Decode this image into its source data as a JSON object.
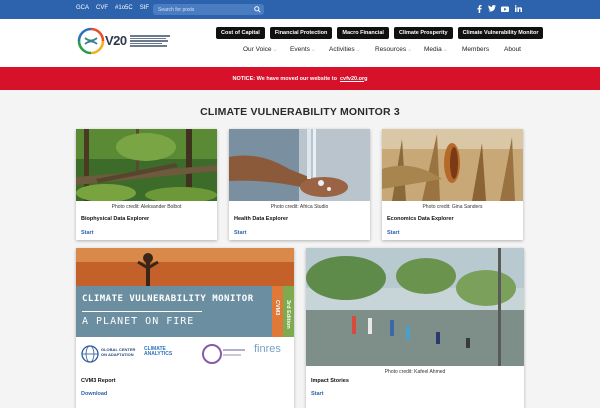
{
  "topbar": {
    "quick_links": [
      "GCA",
      "CVF",
      "#1o5C",
      "SIF"
    ],
    "search_placeholder": "Search for posts",
    "social_icons": [
      "facebook-icon",
      "twitter-icon",
      "youtube-icon",
      "linkedin-icon"
    ]
  },
  "header": {
    "logo_text": "V20",
    "pills": [
      "Cost of Capital",
      "Financial Protection",
      "Macro Financial",
      "Climate Prosperity",
      "Climate Vulnerability Monitor"
    ],
    "nav": [
      {
        "label": "Our Voice",
        "dropdown": true
      },
      {
        "label": "Events",
        "dropdown": true
      },
      {
        "label": "Activities",
        "dropdown": true
      },
      {
        "label": "Resources",
        "dropdown": true
      },
      {
        "label": "Media",
        "dropdown": true
      },
      {
        "label": "Members",
        "dropdown": false
      },
      {
        "label": "About",
        "dropdown": false
      }
    ]
  },
  "notice": {
    "text": "NOTICE: We have moved our website to",
    "link": "cvfv20.org"
  },
  "main": {
    "title": "CLIMATE VULNERABILITY MONITOR 3",
    "cards": [
      {
        "credit": "Photo credit: Aleksander Bolbot",
        "title": "Biophysical Data Explorer",
        "link": "Start"
      },
      {
        "credit": "Photo credit: Africa Studio",
        "title": "Health Data Explorer",
        "link": "Start"
      },
      {
        "credit": "Photo credit: Gina Sanders",
        "title": "Economics Data Explorer",
        "link": "Start"
      }
    ],
    "report_card": {
      "banner_line1": "CLIMATE VULNERABILITY MONITOR",
      "banner_line2": "A PLANET ON FIRE",
      "side_label_1": "CVM3",
      "side_label_2": "3rd Edition",
      "partners": [
        "GLOBAL CENTER ON ADAPTATION",
        "CLIMATE ANALYTICS",
        "finres"
      ],
      "title": "CVM3 Report",
      "link": "Download"
    },
    "impact_card": {
      "credit": "Photo credit: Kafeel Ahmed",
      "title": "Impact Stories",
      "link": "Start"
    }
  },
  "colors": {
    "topbar": "#2d62ad",
    "notice": "#d8112a",
    "link": "#2d62ad"
  }
}
